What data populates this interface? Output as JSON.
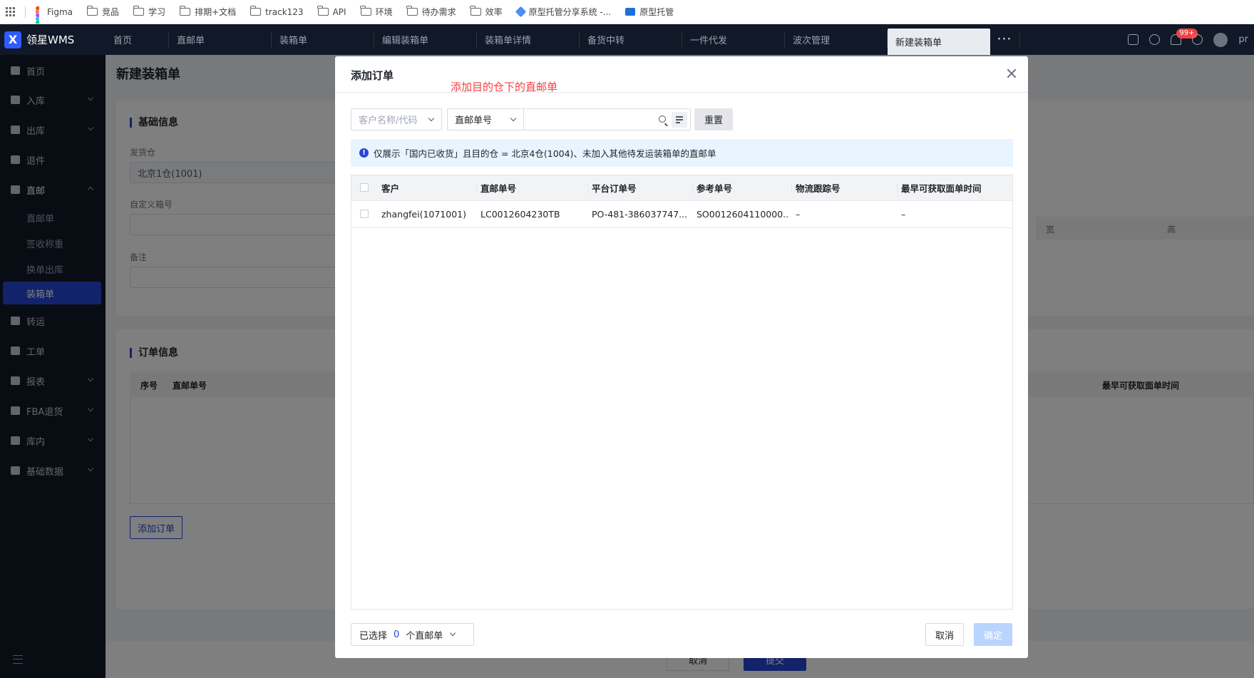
{
  "bookmarks": [
    {
      "label": "Figma",
      "icon": "figma-icon"
    },
    {
      "label": "竞品",
      "icon": "folder-icon"
    },
    {
      "label": "学习",
      "icon": "folder-icon"
    },
    {
      "label": "排期+文档",
      "icon": "folder-icon"
    },
    {
      "label": "track123",
      "icon": "folder-icon"
    },
    {
      "label": "API",
      "icon": "folder-icon"
    },
    {
      "label": "环境",
      "icon": "folder-icon"
    },
    {
      "label": "待办需求",
      "icon": "folder-icon"
    },
    {
      "label": "效率",
      "icon": "folder-icon"
    },
    {
      "label": "原型托管分享系统 -...",
      "icon": "diamond-icon"
    },
    {
      "label": "原型托管",
      "icon": "page-icon"
    }
  ],
  "app": {
    "name": "领星WMS",
    "logo_letter": "X"
  },
  "tabs": [
    {
      "label": "首页"
    },
    {
      "label": "直邮单"
    },
    {
      "label": "装箱单"
    },
    {
      "label": "编辑装箱单"
    },
    {
      "label": "装箱单详情"
    },
    {
      "label": "备货中转"
    },
    {
      "label": "一件代发"
    },
    {
      "label": "波次管理"
    },
    {
      "label": "新建装箱单",
      "active": true
    }
  ],
  "topbar": {
    "more": "···",
    "badge": "99+",
    "user": "pr"
  },
  "sidebar": {
    "items": [
      {
        "label": "首页"
      },
      {
        "label": "入库"
      },
      {
        "label": "出库"
      },
      {
        "label": "退件"
      },
      {
        "label": "直邮"
      },
      {
        "label": "转运"
      },
      {
        "label": "工单"
      },
      {
        "label": "报表"
      },
      {
        "label": "FBA退货"
      },
      {
        "label": "库内"
      },
      {
        "label": "基础数据"
      }
    ],
    "sub_items": [
      "直邮单",
      "签收称重",
      "换单出库",
      "装箱单"
    ]
  },
  "page": {
    "title": "新建装箱单",
    "basic_section": "基础信息",
    "warehouse_label": "发货仓",
    "warehouse_value": "北京1仓(1001)",
    "box_label": "自定义箱号",
    "remark_label": "备注",
    "order_section": "订单信息",
    "order_cols": [
      "序号",
      "直邮单号"
    ],
    "order_col_right": "最早可获取面单时间",
    "box_col_w": "宽",
    "box_col_h": "高",
    "add_order": "添加订单",
    "cancel": "取消",
    "submit": "提交"
  },
  "modal": {
    "title": "添加订单",
    "annotation": "添加目的仓下的直邮单",
    "customer_placeholder": "客户名称/代码",
    "type_select": "直邮单号",
    "reset": "重置",
    "alert": "仅展示「国内已收货」且目的仓 = 北京4仓(1004)、未加入其他待发运装箱单的直邮单",
    "columns": [
      "客户",
      "直邮单号",
      "平台订单号",
      "参考单号",
      "物流跟踪号",
      "最早可获取面单时间"
    ],
    "rows": [
      [
        "zhangfei(1071001)",
        "LC0012604230TB",
        "PO-481-386037747...",
        "SO0012604110000...",
        "–",
        "–"
      ]
    ],
    "selected_prefix": "已选择",
    "selected_count": "0",
    "selected_suffix": "个直邮单",
    "cancel": "取消",
    "ok": "确定"
  },
  "colors": {
    "accent": "#2546d6",
    "annotation": "#f53f3f",
    "sidebar_bg": "#111827",
    "alert_bg": "#e8f4ff"
  }
}
